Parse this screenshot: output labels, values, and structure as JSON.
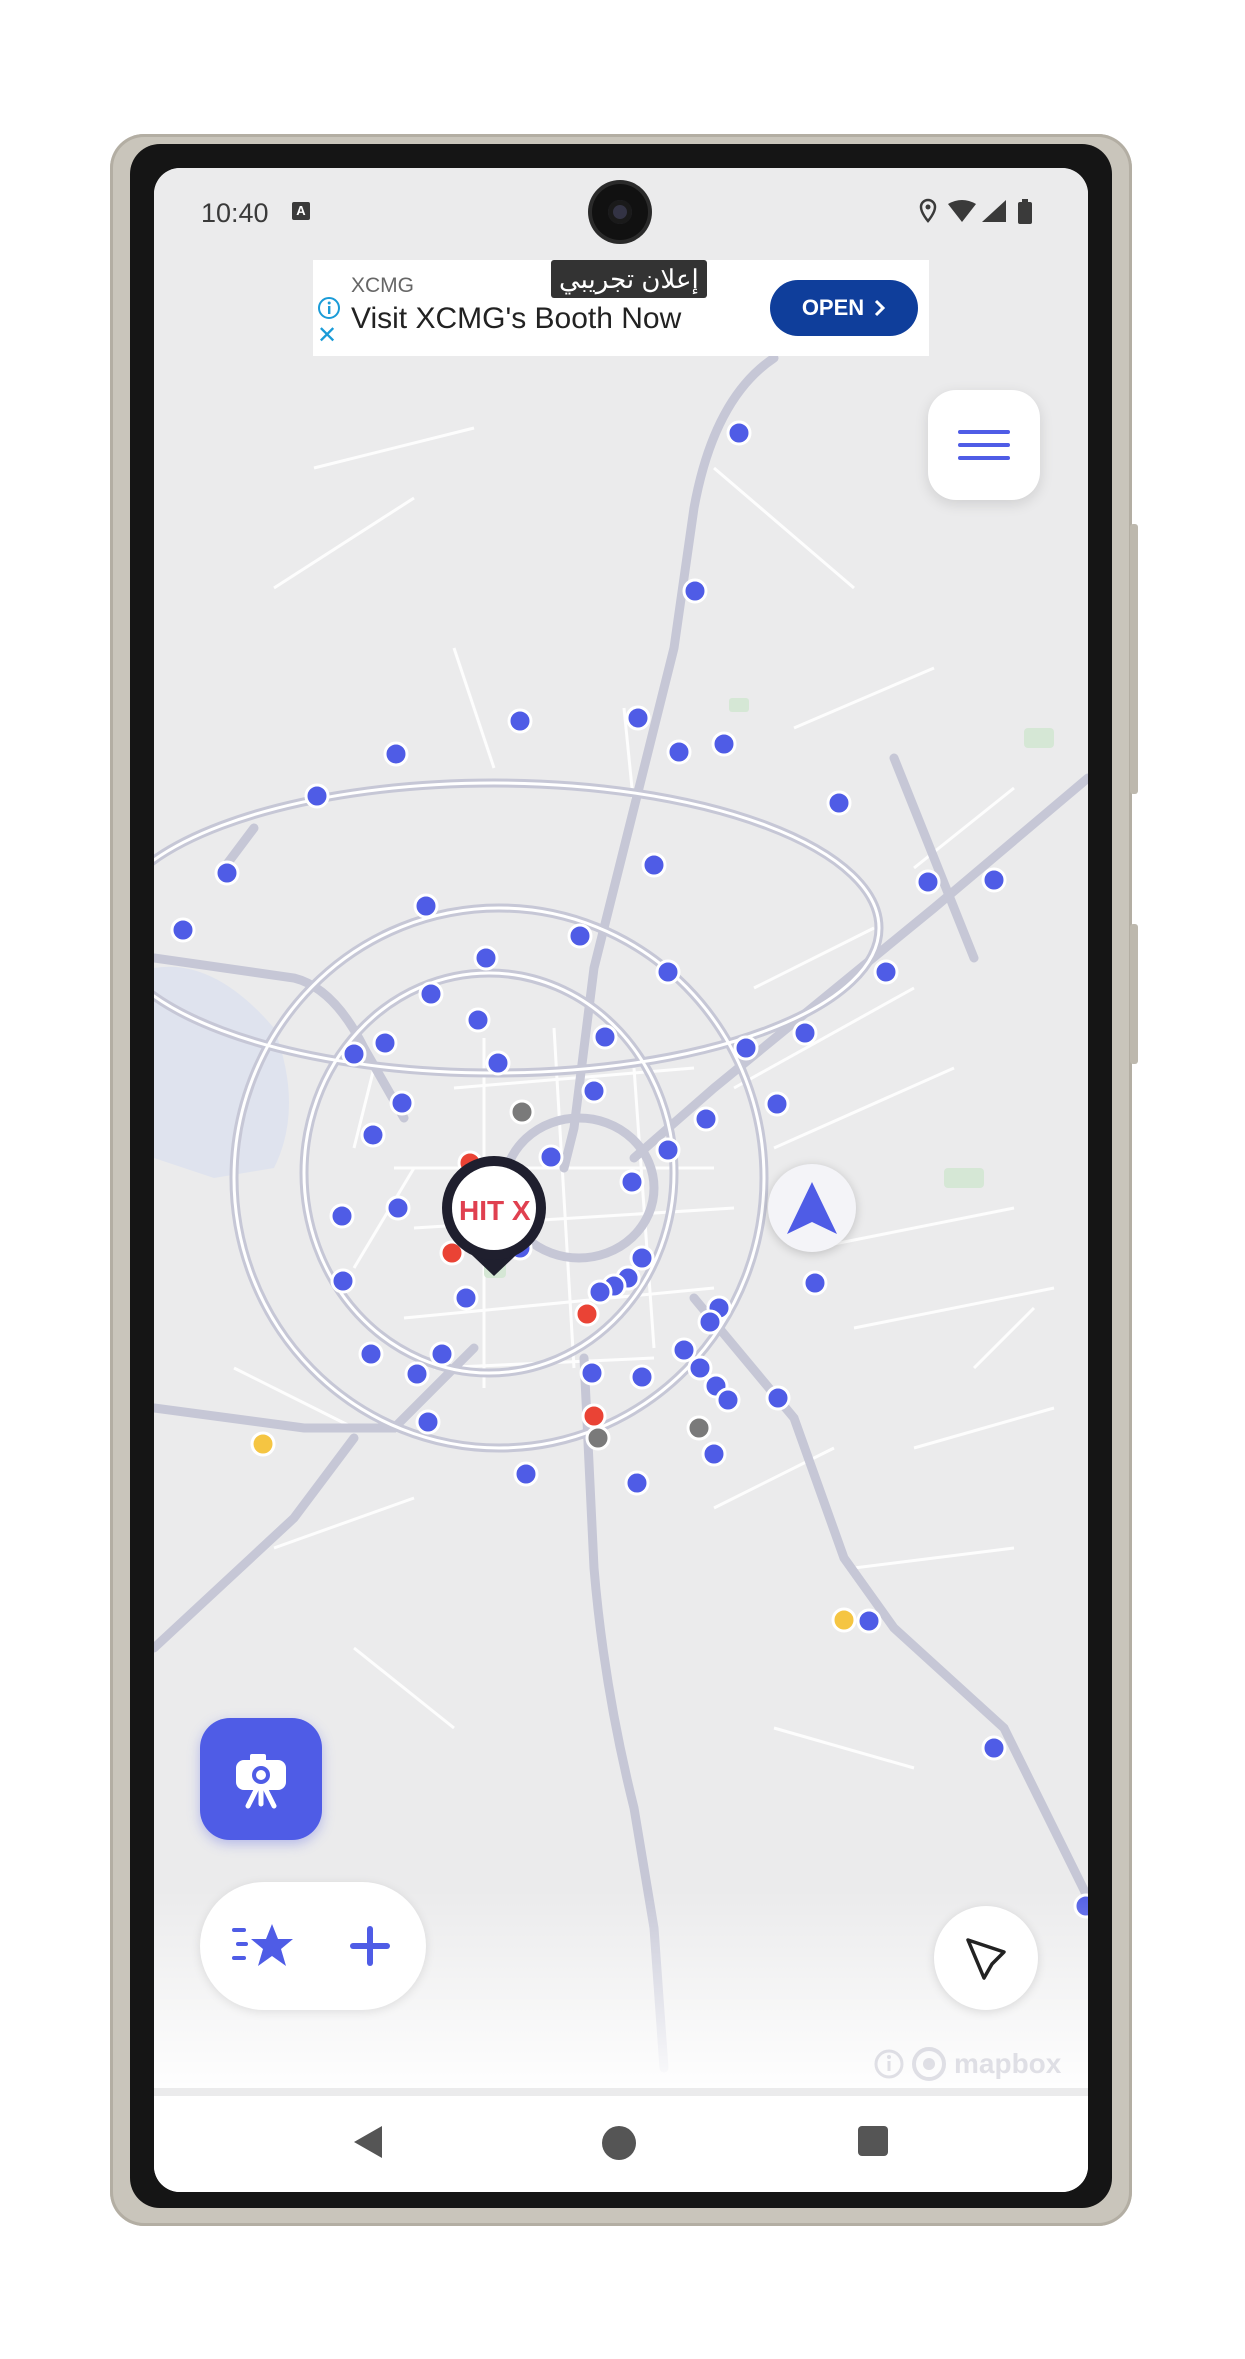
{
  "status_bar": {
    "time": "10:40",
    "notification_letter": "A"
  },
  "ad": {
    "badge": "إعلان تجريبي",
    "advertiser": "XCMG",
    "headline": "Visit XCMG's Booth Now",
    "cta": "OPEN"
  },
  "map": {
    "marker_label": "HIT X",
    "attribution": "mapbox",
    "colors": {
      "speed_camera": "#4f5ce6",
      "red_point": "#ea4335",
      "gray_point": "#7a7a7a",
      "yellow_point": "#f5c542",
      "road": "#c8c8d6"
    }
  },
  "controls": {
    "menu_icon": "hamburger-icon",
    "locate_icon": "navigation-arrow-icon",
    "camera_icon": "speed-camera-icon",
    "favorites_icon": "star-list-icon",
    "add_icon": "plus-icon",
    "route_icon": "route-pointer-icon"
  },
  "system_nav": {
    "back": "back-icon",
    "home": "home-icon",
    "recents": "recents-icon"
  }
}
